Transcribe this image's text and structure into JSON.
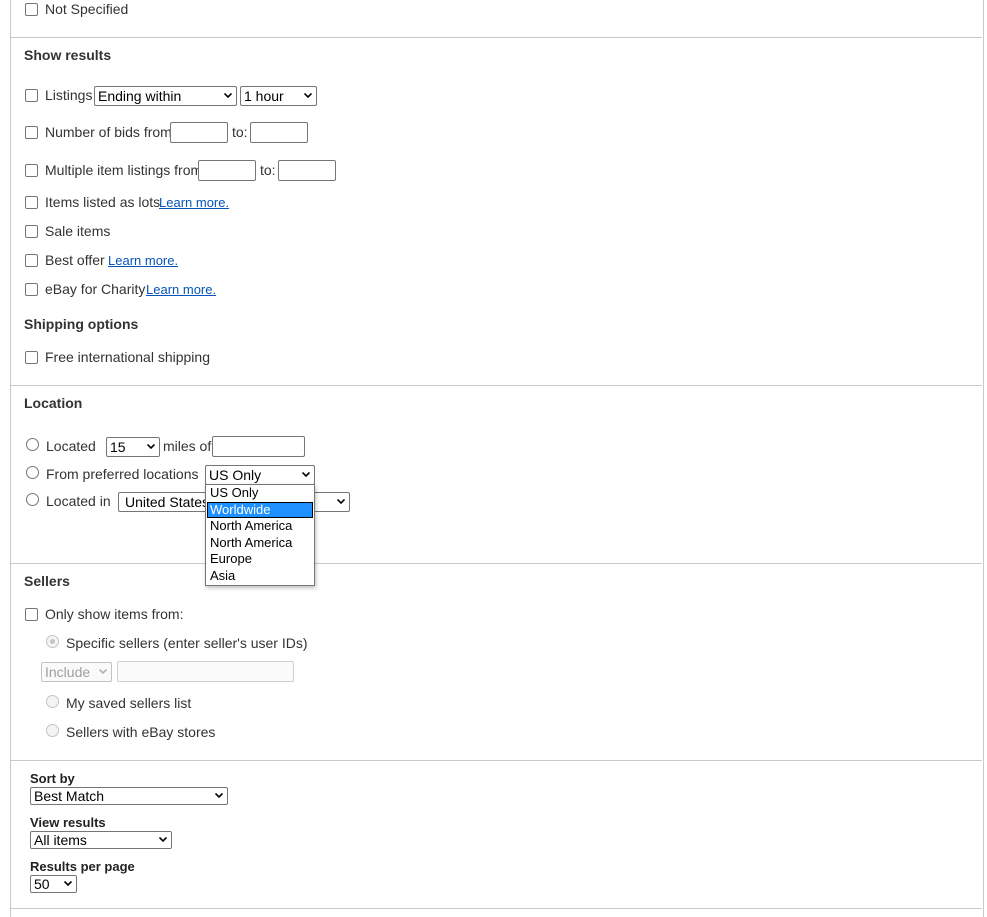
{
  "item_condition": {
    "not_specified": "Not Specified"
  },
  "show_results": {
    "heading": "Show results",
    "listings_label": "Listings",
    "listings_select": "Ending within",
    "listings_time": "1 hour",
    "bids_label": "Number of bids from:",
    "bids_to": "to:",
    "multi_label": "Multiple item listings from:",
    "multi_to": "to:",
    "lots_label": "Items listed as lots",
    "lots_link": "Learn more.",
    "sale_label": "Sale items",
    "best_offer_label": "Best offer",
    "best_offer_link": "Learn more.",
    "charity_label": "eBay for Charity",
    "charity_link": "Learn more."
  },
  "shipping": {
    "heading": "Shipping options",
    "free_intl": "Free international shipping"
  },
  "location": {
    "heading": "Location",
    "located_label": "Located",
    "miles_value": "15",
    "miles_of": "miles of",
    "preferred_label": "From preferred locations",
    "preferred_value": "US Only",
    "located_in_label": "Located in",
    "located_in_value": "United States",
    "dropdown_options": [
      "US Only",
      "Worldwide",
      "North America",
      "North America",
      "Europe",
      "Asia"
    ]
  },
  "sellers": {
    "heading": "Sellers",
    "only_show": "Only show items from:",
    "specific": "Specific sellers (enter seller's user IDs)",
    "include": "Include",
    "saved_list": "My saved sellers list",
    "ebay_stores": "Sellers with eBay stores"
  },
  "sort": {
    "sort_label": "Sort by",
    "sort_value": "Best Match",
    "view_label": "View results",
    "view_value": "All items",
    "per_page_label": "Results per page",
    "per_page_value": "50"
  },
  "colors": {
    "link": "#0654ba",
    "highlight": "#1e90ff",
    "border": "#c8c8c8"
  }
}
